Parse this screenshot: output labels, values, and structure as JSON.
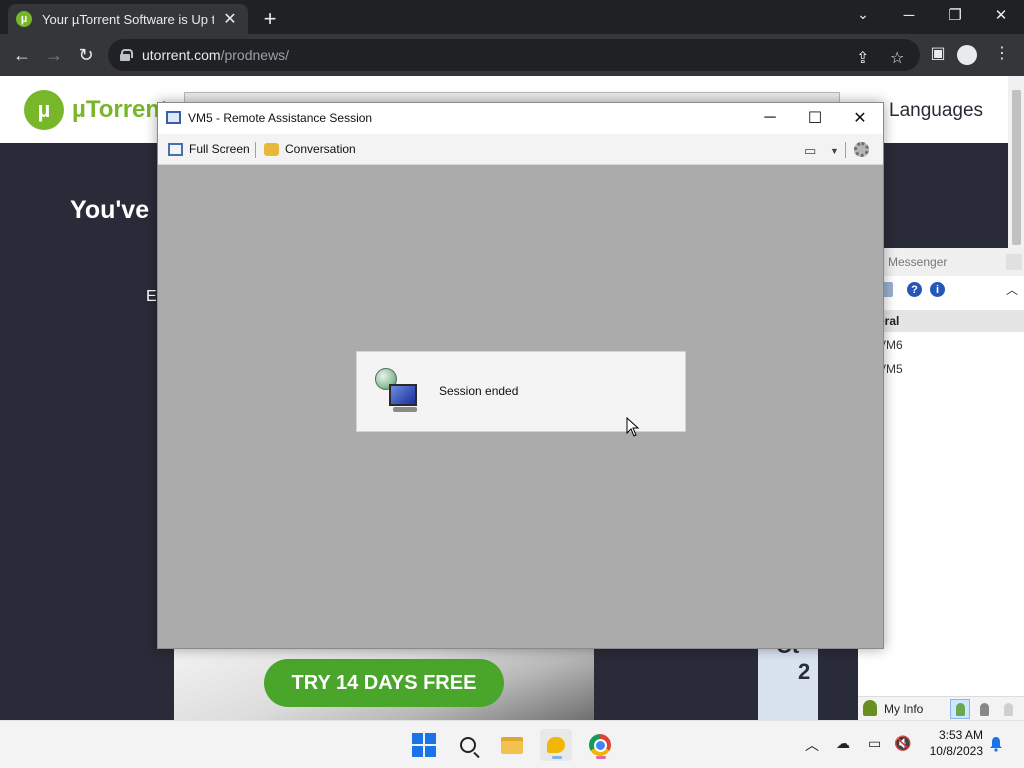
{
  "browser": {
    "tab_title": "Your µTorrent Software is Up to",
    "url_host": "utorrent.com",
    "url_path": "/prodnews/",
    "favicon_letter": "µ"
  },
  "page": {
    "logo_text": "µTorrent",
    "nav_languages": "Languages",
    "hero_title": "You've",
    "hero_sub_fragment": "E",
    "cta_label": "TRY 14 DAYS FREE",
    "card_fragment_1": "Ct",
    "card_fragment_2": "2"
  },
  "remote_assistance": {
    "title": "VM5 - Remote Assistance Session",
    "toolbar": {
      "full_screen": "Full Screen",
      "conversation": "Conversation"
    },
    "dialog_text": "Session ended"
  },
  "messenger": {
    "title_fragment": "N Messenger",
    "group_fragment": "eral",
    "contacts": [
      "VM6",
      "VM5"
    ],
    "my_info": "My Info"
  },
  "taskbar": {
    "time": "3:53 AM",
    "date": "10/8/2023"
  },
  "colors": {
    "utorrent_green": "#78b62a",
    "cta_green": "#4aa52b",
    "chrome_dark": "#202124",
    "remote_bg": "#ababab"
  }
}
